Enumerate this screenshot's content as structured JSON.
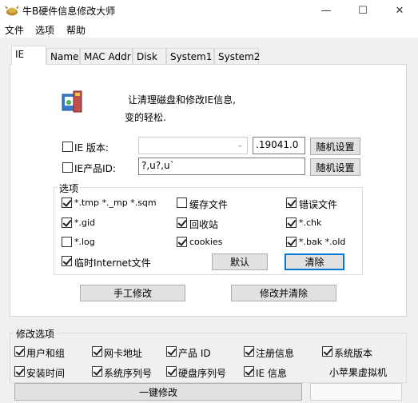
{
  "window": {
    "title": "牛B硬件信息修改大师",
    "minimize_glyph": "—",
    "maximize_glyph": "☐",
    "close_glyph": "✕"
  },
  "menu": [
    "文件",
    "选项",
    "帮助"
  ],
  "tabs": [
    "IE",
    "Name",
    "MAC Addr",
    "Disk",
    "System1",
    "System2"
  ],
  "ie_panel": {
    "description_line1": "让清理磁盘和修改IE信息,",
    "description_line2": "变的轻松.",
    "ie_version": {
      "label": "IE 版本:",
      "combo_value": "",
      "value": ".19041.0",
      "button": "随机设置"
    },
    "ie_product_id": {
      "label": "IE产品ID:",
      "value": "?,u?,u`",
      "button": "随机设置"
    },
    "options_title": "选项",
    "options": [
      {
        "label": "*.tmp  *._mp  *.sqm",
        "checked": true
      },
      {
        "label": "缓存文件",
        "checked": false
      },
      {
        "label": "错误文件",
        "checked": true
      },
      {
        "label": "*.gid",
        "checked": true
      },
      {
        "label": "回收站",
        "checked": true
      },
      {
        "label": "*.chk",
        "checked": true
      },
      {
        "label": "*.log",
        "checked": false
      },
      {
        "label": "cookies",
        "checked": true
      },
      {
        "label": "*.bak  *.old",
        "checked": true
      },
      {
        "label": "临时Internet文件",
        "checked": true
      }
    ],
    "default_button": "默认",
    "clear_button": "清除",
    "manual_button": "手工修改",
    "modify_clear_button": "修改并清除"
  },
  "modify_options": {
    "title": "修改选项",
    "items": [
      {
        "label": "用户和组",
        "checked": true
      },
      {
        "label": "网卡地址",
        "checked": true
      },
      {
        "label": "产品 ID",
        "checked": true
      },
      {
        "label": "注册信息",
        "checked": true
      },
      {
        "label": "系统版本",
        "checked": true
      },
      {
        "label": "安装时间",
        "checked": true
      },
      {
        "label": "系统序列号",
        "checked": true
      },
      {
        "label": "硬盘序列号",
        "checked": true
      },
      {
        "label": "IE 信息",
        "checked": true
      }
    ],
    "side_text": "小苹果虚拟机"
  },
  "footer": {
    "one_click_button": "一键修改"
  },
  "colors": {
    "focus_border": "#0078d7",
    "button_face": "#e1e1e1",
    "panel_bg": "#ffffff"
  }
}
